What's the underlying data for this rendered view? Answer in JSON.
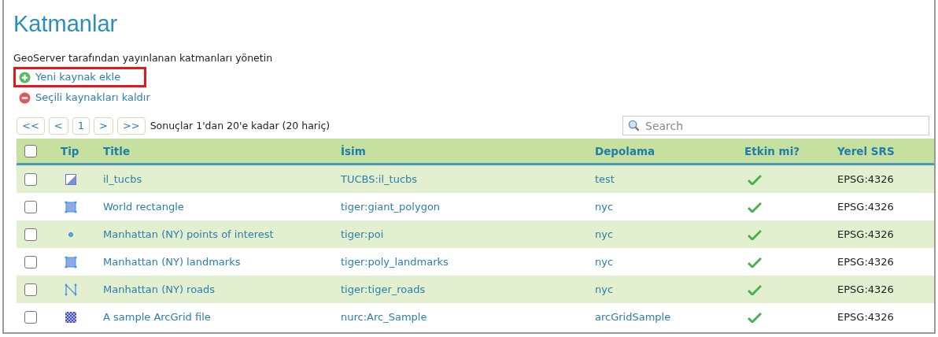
{
  "title": "Katmanlar",
  "description": "GeoServer tarafından yayınlanan katmanları yönetin",
  "actions": [
    {
      "kind": "add",
      "label": "Yeni kaynak ekle",
      "highlighted": true
    },
    {
      "kind": "remove",
      "label": "Seçili kaynakları kaldır",
      "highlighted": false
    }
  ],
  "pager": {
    "buttons": [
      "<<",
      "<",
      "1",
      ">",
      ">>"
    ],
    "summary": "Sonuçlar 1'dan 20'e kadar (20 hariç)"
  },
  "search": {
    "placeholder": "Search"
  },
  "table": {
    "select_all_checked": false,
    "columns": [
      "Tip",
      "Title",
      "İsim",
      "Depolama",
      "Etkin mi?",
      "Yerel SRS"
    ],
    "rows": [
      {
        "checked": false,
        "kind": "raster",
        "title": "il_tucbs",
        "name": "TUCBS:il_tucbs",
        "store": "test",
        "enabled": true,
        "srs": "EPSG:4326"
      },
      {
        "checked": false,
        "kind": "polygon",
        "title": "World rectangle",
        "name": "tiger:giant_polygon",
        "store": "nyc",
        "enabled": true,
        "srs": "EPSG:4326"
      },
      {
        "checked": false,
        "kind": "point",
        "title": "Manhattan (NY) points of interest",
        "name": "tiger:poi",
        "store": "nyc",
        "enabled": true,
        "srs": "EPSG:4326"
      },
      {
        "checked": false,
        "kind": "polygon",
        "title": "Manhattan (NY) landmarks",
        "name": "tiger:poly_landmarks",
        "store": "nyc",
        "enabled": true,
        "srs": "EPSG:4326"
      },
      {
        "checked": false,
        "kind": "line",
        "title": "Manhattan (NY) roads",
        "name": "tiger:tiger_roads",
        "store": "nyc",
        "enabled": true,
        "srs": "EPSG:4326"
      },
      {
        "checked": false,
        "kind": "grid",
        "title": "A sample ArcGrid file",
        "name": "nurc:Arc_Sample",
        "store": "arcGridSample",
        "enabled": true,
        "srs": "EPSG:4326"
      }
    ]
  }
}
